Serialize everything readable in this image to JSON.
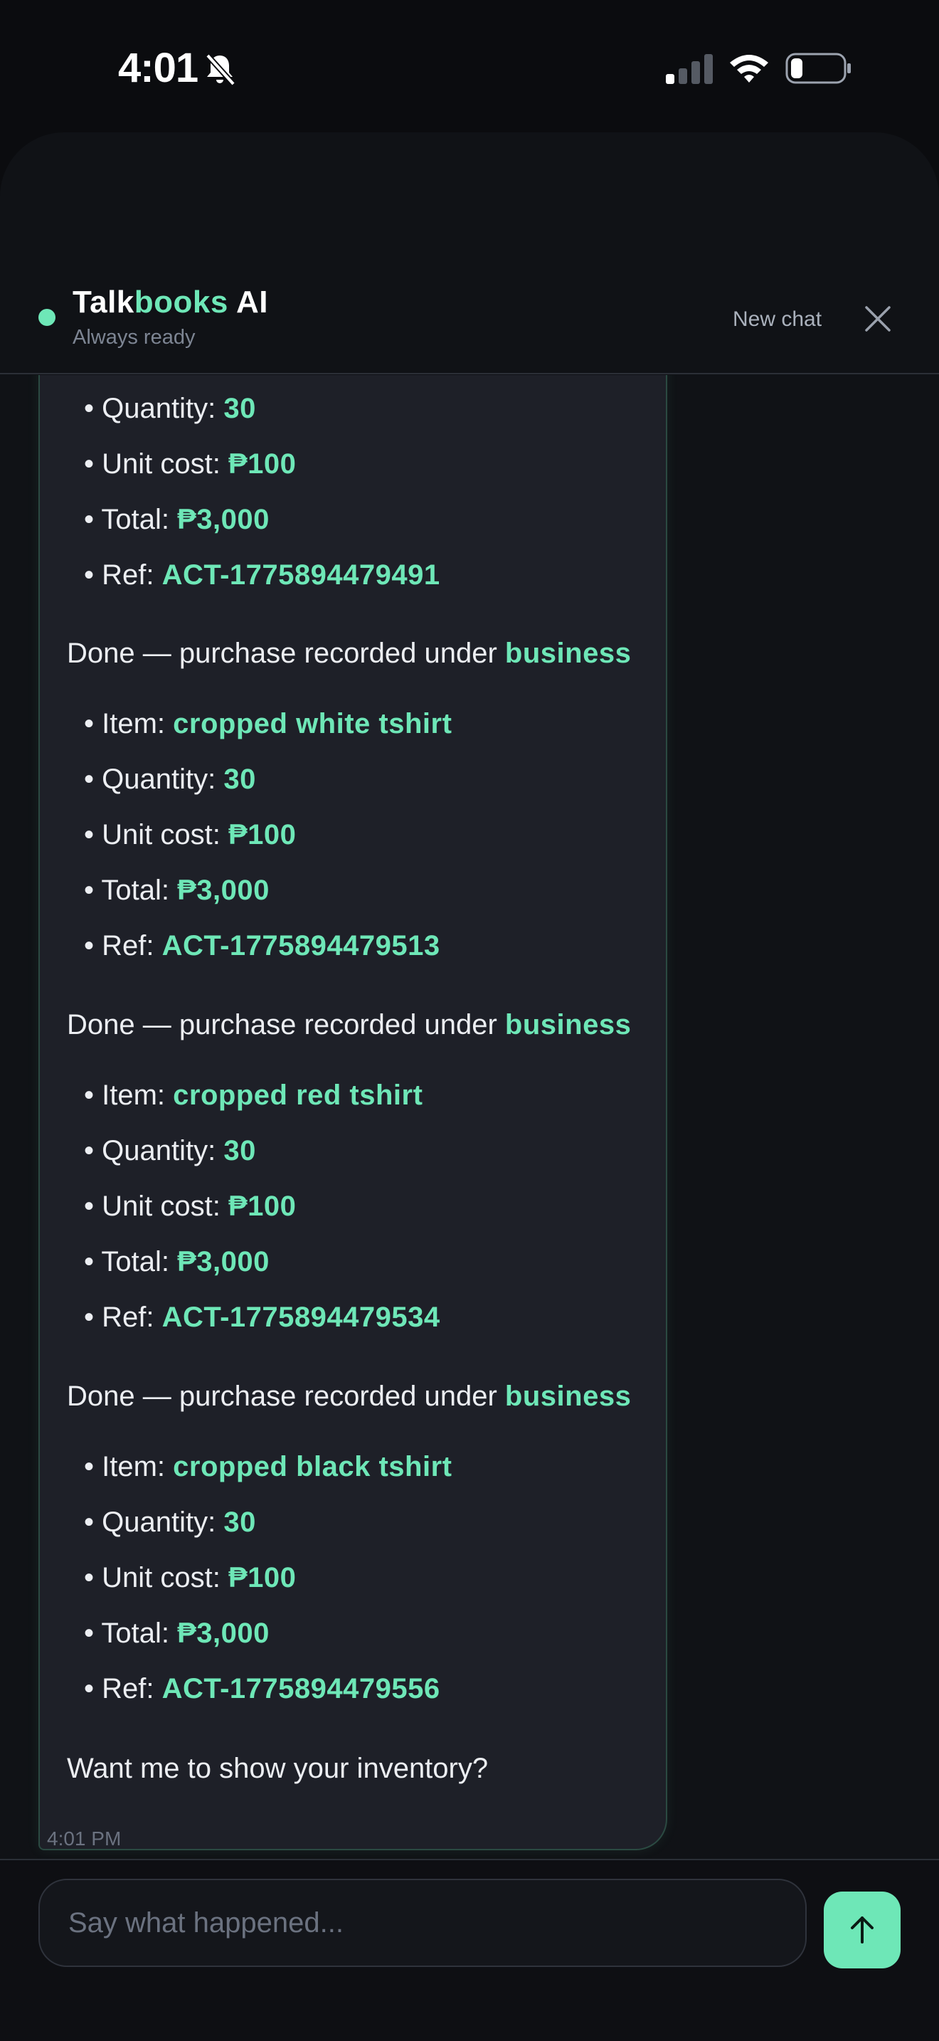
{
  "status_bar": {
    "time": "4:01",
    "icons": [
      "bell-off-icon",
      "signal-icon",
      "wifi-icon",
      "battery-icon"
    ]
  },
  "header": {
    "brand_part1": "Talk",
    "brand_part2": "books",
    "brand_part3": " AI",
    "subtitle": "Always ready",
    "new_chat_label": "New chat"
  },
  "message": {
    "first_group": [
      {
        "label": "Quantity: ",
        "value": "30"
      },
      {
        "label": "Unit cost: ",
        "value": "₱100"
      },
      {
        "label": "Total: ",
        "value": "₱3,000"
      },
      {
        "label": "Ref: ",
        "value": "ACT-1775894479491"
      }
    ],
    "groups": [
      {
        "intro": "Done — purchase recorded under ",
        "intro_highlight": "business",
        "items": [
          {
            "label": "Item: ",
            "value": "cropped white tshirt"
          },
          {
            "label": "Quantity: ",
            "value": "30"
          },
          {
            "label": "Unit cost: ",
            "value": "₱100"
          },
          {
            "label": "Total: ",
            "value": "₱3,000"
          },
          {
            "label": "Ref: ",
            "value": "ACT-1775894479513"
          }
        ]
      },
      {
        "intro": "Done — purchase recorded under ",
        "intro_highlight": "business",
        "items": [
          {
            "label": "Item: ",
            "value": "cropped red tshirt"
          },
          {
            "label": "Quantity: ",
            "value": "30"
          },
          {
            "label": "Unit cost: ",
            "value": "₱100"
          },
          {
            "label": "Total: ",
            "value": "₱3,000"
          },
          {
            "label": "Ref: ",
            "value": "ACT-1775894479534"
          }
        ]
      },
      {
        "intro": "Done — purchase recorded under ",
        "intro_highlight": "business",
        "items": [
          {
            "label": "Item: ",
            "value": "cropped black tshirt"
          },
          {
            "label": "Quantity: ",
            "value": "30"
          },
          {
            "label": "Unit cost: ",
            "value": "₱100"
          },
          {
            "label": "Total: ",
            "value": "₱3,000"
          },
          {
            "label": "Ref: ",
            "value": "ACT-1775894479556"
          }
        ]
      }
    ],
    "closing": "Want me to show your inventory?",
    "timestamp": "4:01 PM"
  },
  "composer": {
    "placeholder": "Say what happened..."
  },
  "colors": {
    "accent": "#6ee7b7",
    "background": "#101216",
    "bubble": "#1e2028"
  }
}
